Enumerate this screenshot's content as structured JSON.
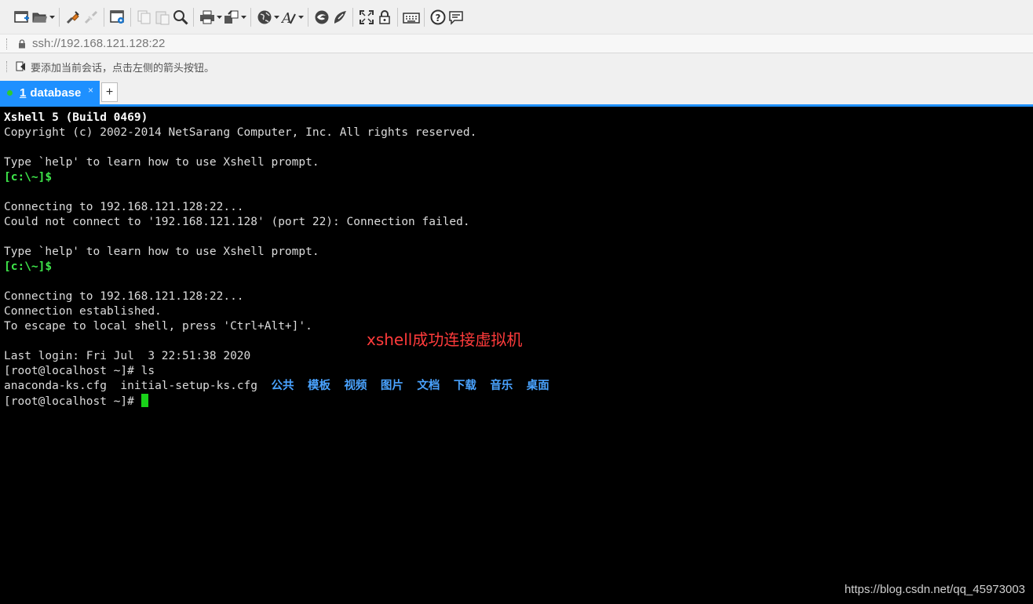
{
  "toolbar": {
    "buttons": [
      {
        "name": "new-session-icon",
        "caret": false,
        "disabled": false
      },
      {
        "name": "open-folder-icon",
        "caret": true,
        "disabled": false
      },
      {
        "name": "reconnect-icon",
        "caret": false,
        "disabled": false
      },
      {
        "name": "disconnect-icon",
        "caret": false,
        "disabled": true
      },
      {
        "name": "session-properties-icon",
        "caret": false,
        "disabled": false
      },
      {
        "name": "copy-icon",
        "caret": false,
        "disabled": true
      },
      {
        "name": "paste-icon",
        "caret": false,
        "disabled": true
      },
      {
        "name": "find-icon",
        "caret": false,
        "disabled": false
      },
      {
        "name": "print-icon",
        "caret": true,
        "disabled": false
      },
      {
        "name": "transfer-icon",
        "caret": true,
        "disabled": false
      },
      {
        "name": "globe-icon",
        "caret": true,
        "disabled": false
      },
      {
        "name": "font-icon",
        "caret": true,
        "disabled": false
      },
      {
        "name": "xftp-icon",
        "caret": false,
        "disabled": false
      },
      {
        "name": "script-icon",
        "caret": false,
        "disabled": false
      },
      {
        "name": "fullscreen-icon",
        "caret": false,
        "disabled": false
      },
      {
        "name": "lock-icon",
        "caret": false,
        "disabled": false
      },
      {
        "name": "keyboard-icon",
        "caret": false,
        "disabled": false
      },
      {
        "name": "help-icon",
        "caret": false,
        "disabled": false
      },
      {
        "name": "chat-icon",
        "caret": false,
        "disabled": false
      }
    ]
  },
  "address": {
    "url": "ssh://192.168.121.128:22"
  },
  "hint": {
    "text": "要添加当前会话，点击左侧的箭头按钮。"
  },
  "tabs": [
    {
      "number": "1",
      "label": "database",
      "close": "×"
    }
  ],
  "tab_add": "+",
  "terminal": {
    "banner_title": "Xshell 5 (Build 0469)",
    "copyright": "Copyright (c) 2002-2014 NetSarang Computer, Inc. All rights reserved.",
    "help1": "Type `help' to learn how to use Xshell prompt.",
    "prompt1": "[c:\\~]$",
    "connecting1": "Connecting to 192.168.121.128:22...",
    "failed": "Could not connect to '192.168.121.128' (port 22): Connection failed.",
    "help2": "Type `help' to learn how to use Xshell prompt.",
    "prompt2": "[c:\\~]$",
    "connecting2": "Connecting to 192.168.121.128:22...",
    "established": "Connection established.",
    "escape": "To escape to local shell, press 'Ctrl+Alt+]'.",
    "last_login": "Last login: Fri Jul  3 22:51:38 2020",
    "cmd_ls": "[root@localhost ~]# ls",
    "files": [
      "anaconda-ks.cfg",
      "initial-setup-ks.cfg"
    ],
    "dirs": [
      "公共",
      "模板",
      "视频",
      "图片",
      "文档",
      "下载",
      "音乐",
      "桌面"
    ],
    "prompt3": "[root@localhost ~]# "
  },
  "annotation": "xshell成功连接虚拟机",
  "watermark": "https://blog.csdn.net/qq_45973003",
  "colors": {
    "tab_active": "#1e90ff",
    "prompt_green": "#3ee64a",
    "dir_blue": "#4aa3ff",
    "annotation_red": "#ff3b3b",
    "cursor": "#19d219"
  }
}
